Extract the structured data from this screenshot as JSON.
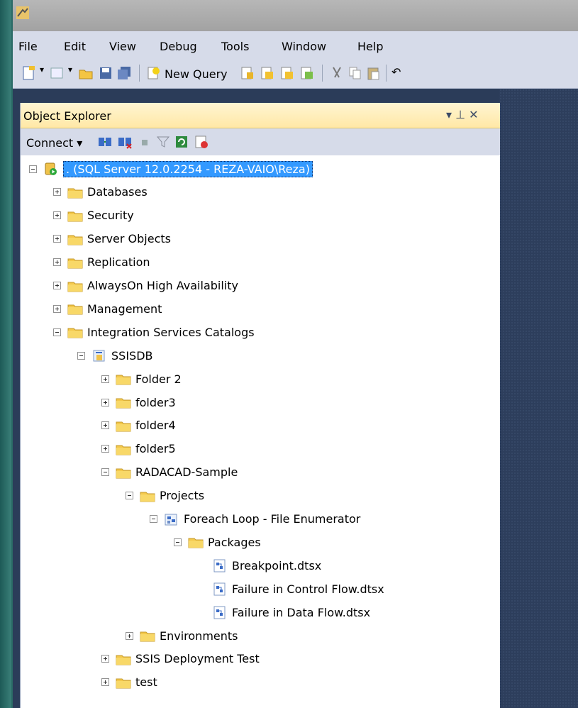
{
  "menu": [
    "File",
    "Edit",
    "View",
    "Debug",
    "Tools",
    "Window",
    "Help"
  ],
  "toolbar": {
    "new_query_label": "New Query"
  },
  "object_explorer": {
    "title": "Object Explorer",
    "pin_glyph": "▾ ⊥ ✕",
    "connect_label": "Connect ▾"
  },
  "tree": [
    {
      "label": ". (SQL Server 12.0.2254 - REZA-VAIO\\Reza)",
      "depth": 0,
      "state": "expanded",
      "icon": "server-icon",
      "selected": true
    },
    {
      "label": "Databases",
      "depth": 1,
      "state": "collapsed",
      "icon": "folder-icon"
    },
    {
      "label": "Security",
      "depth": 1,
      "state": "collapsed",
      "icon": "folder-icon"
    },
    {
      "label": "Server Objects",
      "depth": 1,
      "state": "collapsed",
      "icon": "folder-icon"
    },
    {
      "label": "Replication",
      "depth": 1,
      "state": "collapsed",
      "icon": "folder-icon"
    },
    {
      "label": "AlwaysOn High Availability",
      "depth": 1,
      "state": "collapsed",
      "icon": "folder-icon"
    },
    {
      "label": "Management",
      "depth": 1,
      "state": "collapsed",
      "icon": "folder-icon"
    },
    {
      "label": "Integration Services Catalogs",
      "depth": 1,
      "state": "expanded",
      "icon": "folder-icon"
    },
    {
      "label": "SSISDB",
      "depth": 2,
      "state": "expanded",
      "icon": "catalog-icon"
    },
    {
      "label": "Folder 2",
      "depth": 3,
      "state": "collapsed",
      "icon": "folder-icon"
    },
    {
      "label": "folder3",
      "depth": 3,
      "state": "collapsed",
      "icon": "folder-icon"
    },
    {
      "label": "folder4",
      "depth": 3,
      "state": "collapsed",
      "icon": "folder-icon"
    },
    {
      "label": "folder5",
      "depth": 3,
      "state": "collapsed",
      "icon": "folder-icon"
    },
    {
      "label": "RADACAD-Sample",
      "depth": 3,
      "state": "expanded",
      "icon": "folder-icon"
    },
    {
      "label": "Projects",
      "depth": 4,
      "state": "expanded",
      "icon": "folder-icon"
    },
    {
      "label": "Foreach Loop - File Enumerator",
      "depth": 5,
      "state": "expanded",
      "icon": "project-icon"
    },
    {
      "label": "Packages",
      "depth": 6,
      "state": "expanded",
      "icon": "folder-icon"
    },
    {
      "label": "Breakpoint.dtsx",
      "depth": 7,
      "state": "leaf",
      "icon": "package-icon"
    },
    {
      "label": "Failure in Control Flow.dtsx",
      "depth": 7,
      "state": "leaf",
      "icon": "package-icon"
    },
    {
      "label": "Failure in Data Flow.dtsx",
      "depth": 7,
      "state": "leaf",
      "icon": "package-icon"
    },
    {
      "label": "Environments",
      "depth": 4,
      "state": "collapsed",
      "icon": "folder-icon"
    },
    {
      "label": "SSIS Deployment Test",
      "depth": 3,
      "state": "collapsed",
      "icon": "folder-icon"
    },
    {
      "label": "test",
      "depth": 3,
      "state": "collapsed",
      "icon": "folder-icon"
    }
  ]
}
